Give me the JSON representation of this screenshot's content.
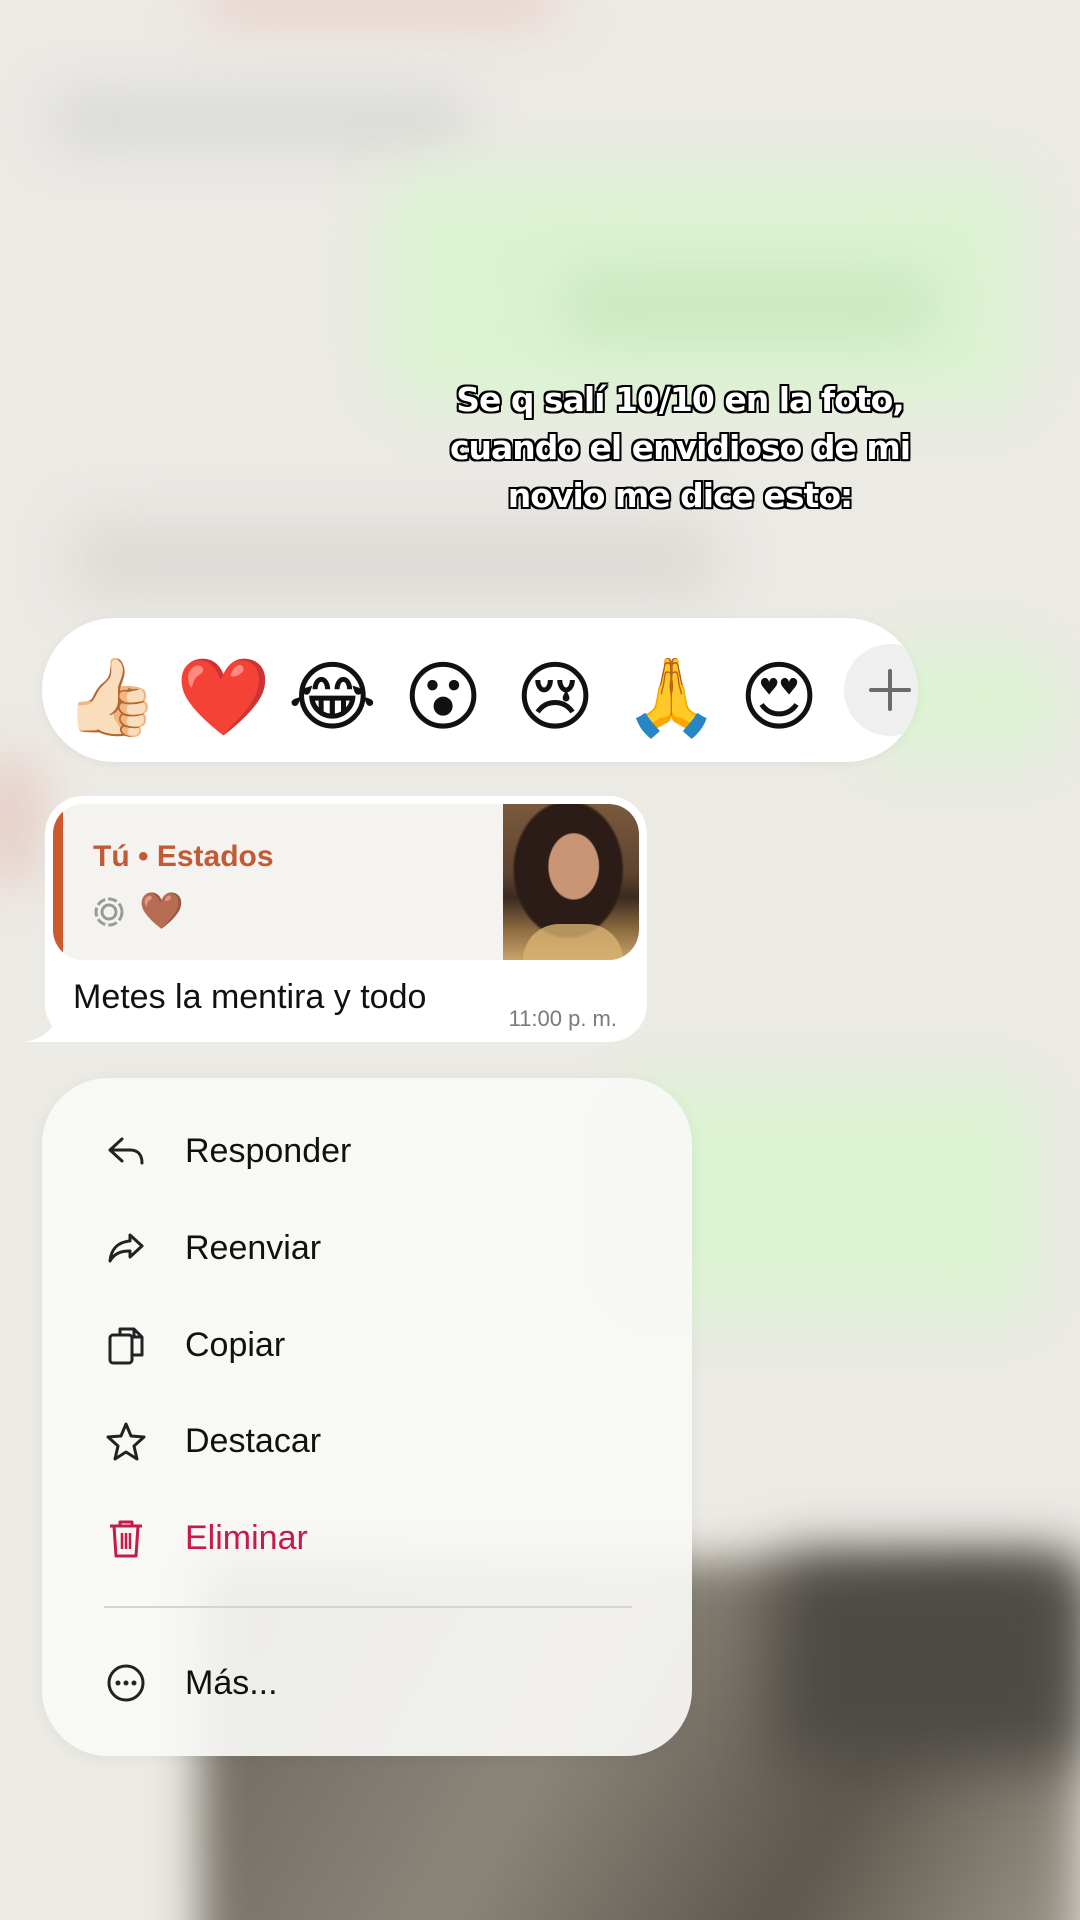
{
  "caption": {
    "line1": "Se q salí 10/10 en la foto,",
    "line2": "cuando el envidioso de mi",
    "line3": "novio me dice esto:"
  },
  "reactions": {
    "emojis": [
      "👍🏻",
      "❤️",
      "😂",
      "😮",
      "😢",
      "🙏",
      "😍"
    ],
    "add_icon": "plus-icon"
  },
  "message": {
    "quote_title": "Tú • Estados",
    "quote_reaction_emoji": "🤎",
    "text": "Metes la mentira y todo",
    "time": "11:00 p. m."
  },
  "menu": {
    "reply": "Responder",
    "forward": "Reenviar",
    "copy": "Copiar",
    "star": "Destacar",
    "delete": "Eliminar",
    "more": "Más..."
  },
  "colors": {
    "quote_accent": "#cc5a2c",
    "quote_title": "#c25a35",
    "danger": "#c61a4a"
  }
}
